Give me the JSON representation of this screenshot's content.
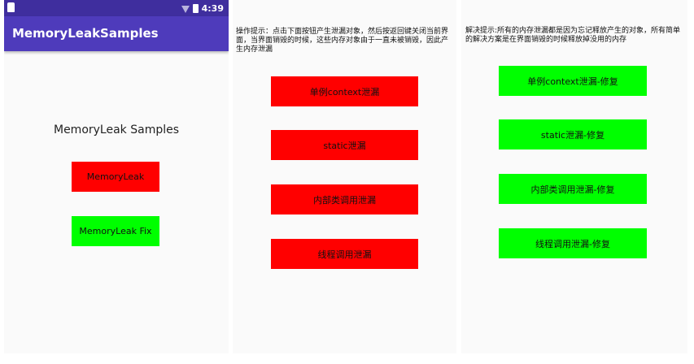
{
  "screen1": {
    "status_time": "4:39",
    "app_title": "MemoryLeakSamples",
    "heading": "MemoryLeak Samples",
    "buttons": [
      {
        "label": "MemoryLeak"
      },
      {
        "label": "MemoryLeak Fix"
      }
    ]
  },
  "screen2": {
    "hint": "操作提示：点击下面按钮产生泄漏对象，然后按返回键关闭当前界面，当界面销毁的时候，这些内存对象由于一直未被销毁，因此产生内存泄漏",
    "buttons": [
      {
        "label": "单例context泄漏"
      },
      {
        "label": "static泄漏"
      },
      {
        "label": "内部类调用泄漏"
      },
      {
        "label": "线程调用泄漏"
      }
    ]
  },
  "screen3": {
    "hint": "解决提示:所有的内存泄漏都是因为忘记释放产生的对象，所有简单的解决方案是在界面销毁的时候释放掉没用的内存",
    "buttons": [
      {
        "label": "单例context泄漏-修复"
      },
      {
        "label": "static泄漏-修复"
      },
      {
        "label": "内部类调用泄漏-修复"
      },
      {
        "label": "线程调用泄漏-修复"
      }
    ]
  },
  "colors": {
    "status_bar": "#3f2e9e",
    "app_bar": "#4e3bbb",
    "leak_button": "#ff0000",
    "fix_button": "#00ff00",
    "screen_bg": "#fafafa"
  }
}
